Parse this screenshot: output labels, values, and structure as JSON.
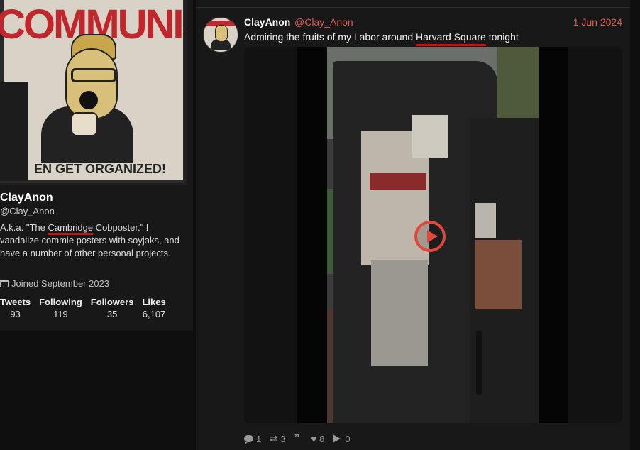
{
  "profile": {
    "banner_title": "COMMUNIST",
    "banner_bottom": "EN GET ORGANIZED!",
    "name": "ClayAnon",
    "handle": "@Clay_Anon",
    "bio_before": "A.k.a. \"The ",
    "bio_underlined": "Cambridge",
    "bio_after": " Cobposter.\" I vandalize commie posters with soyjaks, and have a number of other personal projects.",
    "joined": "Joined September 2023",
    "joined_icon": "calendar-icon",
    "stats": [
      {
        "label": "Tweets",
        "value": "93"
      },
      {
        "label": "Following",
        "value": "119"
      },
      {
        "label": "Followers",
        "value": "35"
      },
      {
        "label": "Likes",
        "value": "6,107"
      }
    ]
  },
  "tweet": {
    "name": "ClayAnon",
    "handle": "@Clay_Anon",
    "date": "1 Jun 2024",
    "text_before": "Admiring the fruits of my Labor around ",
    "text_underlined": "Harvard Square",
    "text_after": " tonight",
    "media_icon": "play-icon",
    "actions": {
      "replies": "1",
      "retweets": "3",
      "quotes": "",
      "likes": "8",
      "views": "0"
    }
  },
  "colors": {
    "accent": "#e05a4f",
    "underline": "#d01010",
    "background": "#0f0f0f",
    "panel": "#181818"
  }
}
